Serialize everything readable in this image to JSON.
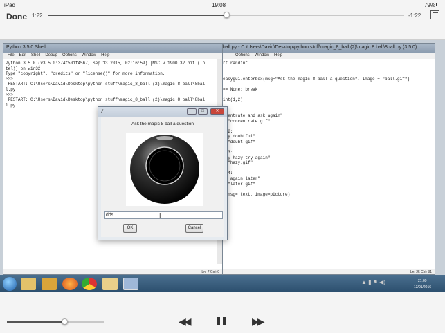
{
  "ipad_status": {
    "device": "iPad",
    "time": "19:08",
    "battery": "79%"
  },
  "player_top": {
    "done_label": "Done",
    "elapsed": "1:22",
    "remaining": "-1:22",
    "progress": 0.5
  },
  "shell": {
    "title": "Python 3.5.0 Shell",
    "menus": [
      "File",
      "Edit",
      "Shell",
      "Debug",
      "Options",
      "Window",
      "Help"
    ],
    "lines": [
      "Python 3.5.0 (v3.5.0:374f501f4567, Sep 13 2015, 02:16:59) [MSC v.1900 32 bit (In",
      "tel)] on win32",
      "Type \"copyright\", \"credits\" or \"license()\" for more information.",
      ">>> ",
      " RESTART: C:\\Users\\David\\Desktop\\python stuff\\magic_8_ball (2)\\magic 8 ball\\8bal",
      "l.py",
      ">>> ",
      " RESTART: C:\\Users\\David\\Desktop\\python stuff\\magic_8_ball (2)\\magic 8 ball\\8bal",
      "l.py"
    ],
    "status": "Ln: 7 Col: 0"
  },
  "editor": {
    "title": "8ball.py - C:\\Users\\David\\Desktop\\python stuff\\magic_8_ball (2)\\magic 8 ball\\8ball.py (3.5.0)",
    "menus": [
      "Options",
      "Window",
      "Help"
    ],
    "lines": [
      "rt randint",
      "",
      "",
      "easygui.enterbox(msg=\"Ask the magic 8 ball a question\", image = \"ball.gif\")",
      "",
      "== None: break",
      "",
      "int(1,2)",
      "",
      "1:",
      "ncentrate and ask again\"",
      "  \"concentrate.gif\"",
      "",
      "= 2:",
      "ery doubtful\"",
      "  \"doubt.gif\"",
      "",
      "= 3:",
      "ery hazy try again\"",
      "  \"hazy.gif\"",
      "",
      "= 4:",
      "sk again later\"",
      "  \"later.gif\"",
      "",
      "x(msg= text, image=picture)"
    ],
    "status": "Ln: 25 Col: 31"
  },
  "dialog": {
    "prompt": "Ask the magic 8 ball a question",
    "input_value": "dds",
    "ok_label": "OK",
    "cancel_label": "Cancel"
  },
  "taskbar": {
    "clock_time": "21:09",
    "clock_date": "13/01/2016",
    "icons": [
      "start-orb-icon",
      "folder-icon",
      "media-player-icon",
      "firefox-icon",
      "chrome-icon",
      "explorer-icon",
      "python-icon"
    ]
  },
  "player_bottom": {
    "volume": 0.59
  }
}
